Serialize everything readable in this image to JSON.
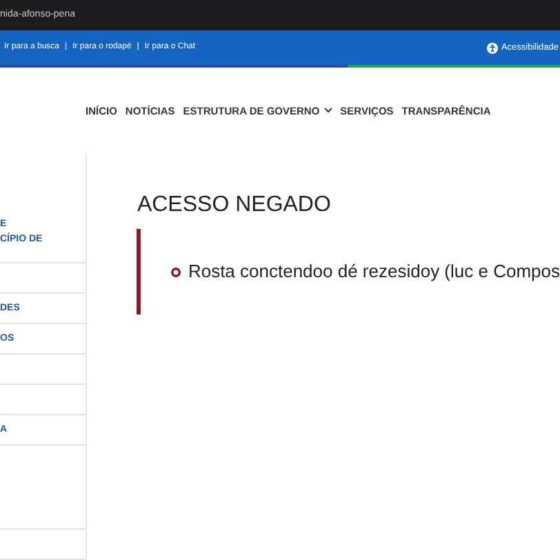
{
  "address_bar": {
    "url": "nida-afonso-pena"
  },
  "skip_links": [
    "Ir para a busca",
    "Ir para o rodapé",
    "Ir para o Chat"
  ],
  "skip_separator": "|",
  "accessibility": {
    "label": "Acessibilidade"
  },
  "nav": [
    {
      "label": "INÍCIO",
      "dropdown": false
    },
    {
      "label": "NOTÍCIAS",
      "dropdown": false
    },
    {
      "label": "ESTRUTURA DE GOVERNO",
      "dropdown": true
    },
    {
      "label": "SERVIÇOS",
      "dropdown": false
    },
    {
      "label": "TRANSPARÊNCIA",
      "dropdown": false
    }
  ],
  "sidebar": {
    "items": [
      {
        "kind": "link",
        "lines": [
          "E",
          "CÍPIO DE"
        ]
      },
      {
        "kind": "blank"
      },
      {
        "kind": "link",
        "lines": [
          "DES"
        ]
      },
      {
        "kind": "link",
        "lines": [
          "OS"
        ]
      },
      {
        "kind": "blank"
      },
      {
        "kind": "blank"
      },
      {
        "kind": "link",
        "lines": [
          "A"
        ]
      },
      {
        "kind": "tall"
      },
      {
        "kind": "blank"
      }
    ]
  },
  "content": {
    "title": "ACESSO NEGADO",
    "messages": [
      "Rosta conctendoo dé rezesidoy (luc e Compos"
    ]
  }
}
